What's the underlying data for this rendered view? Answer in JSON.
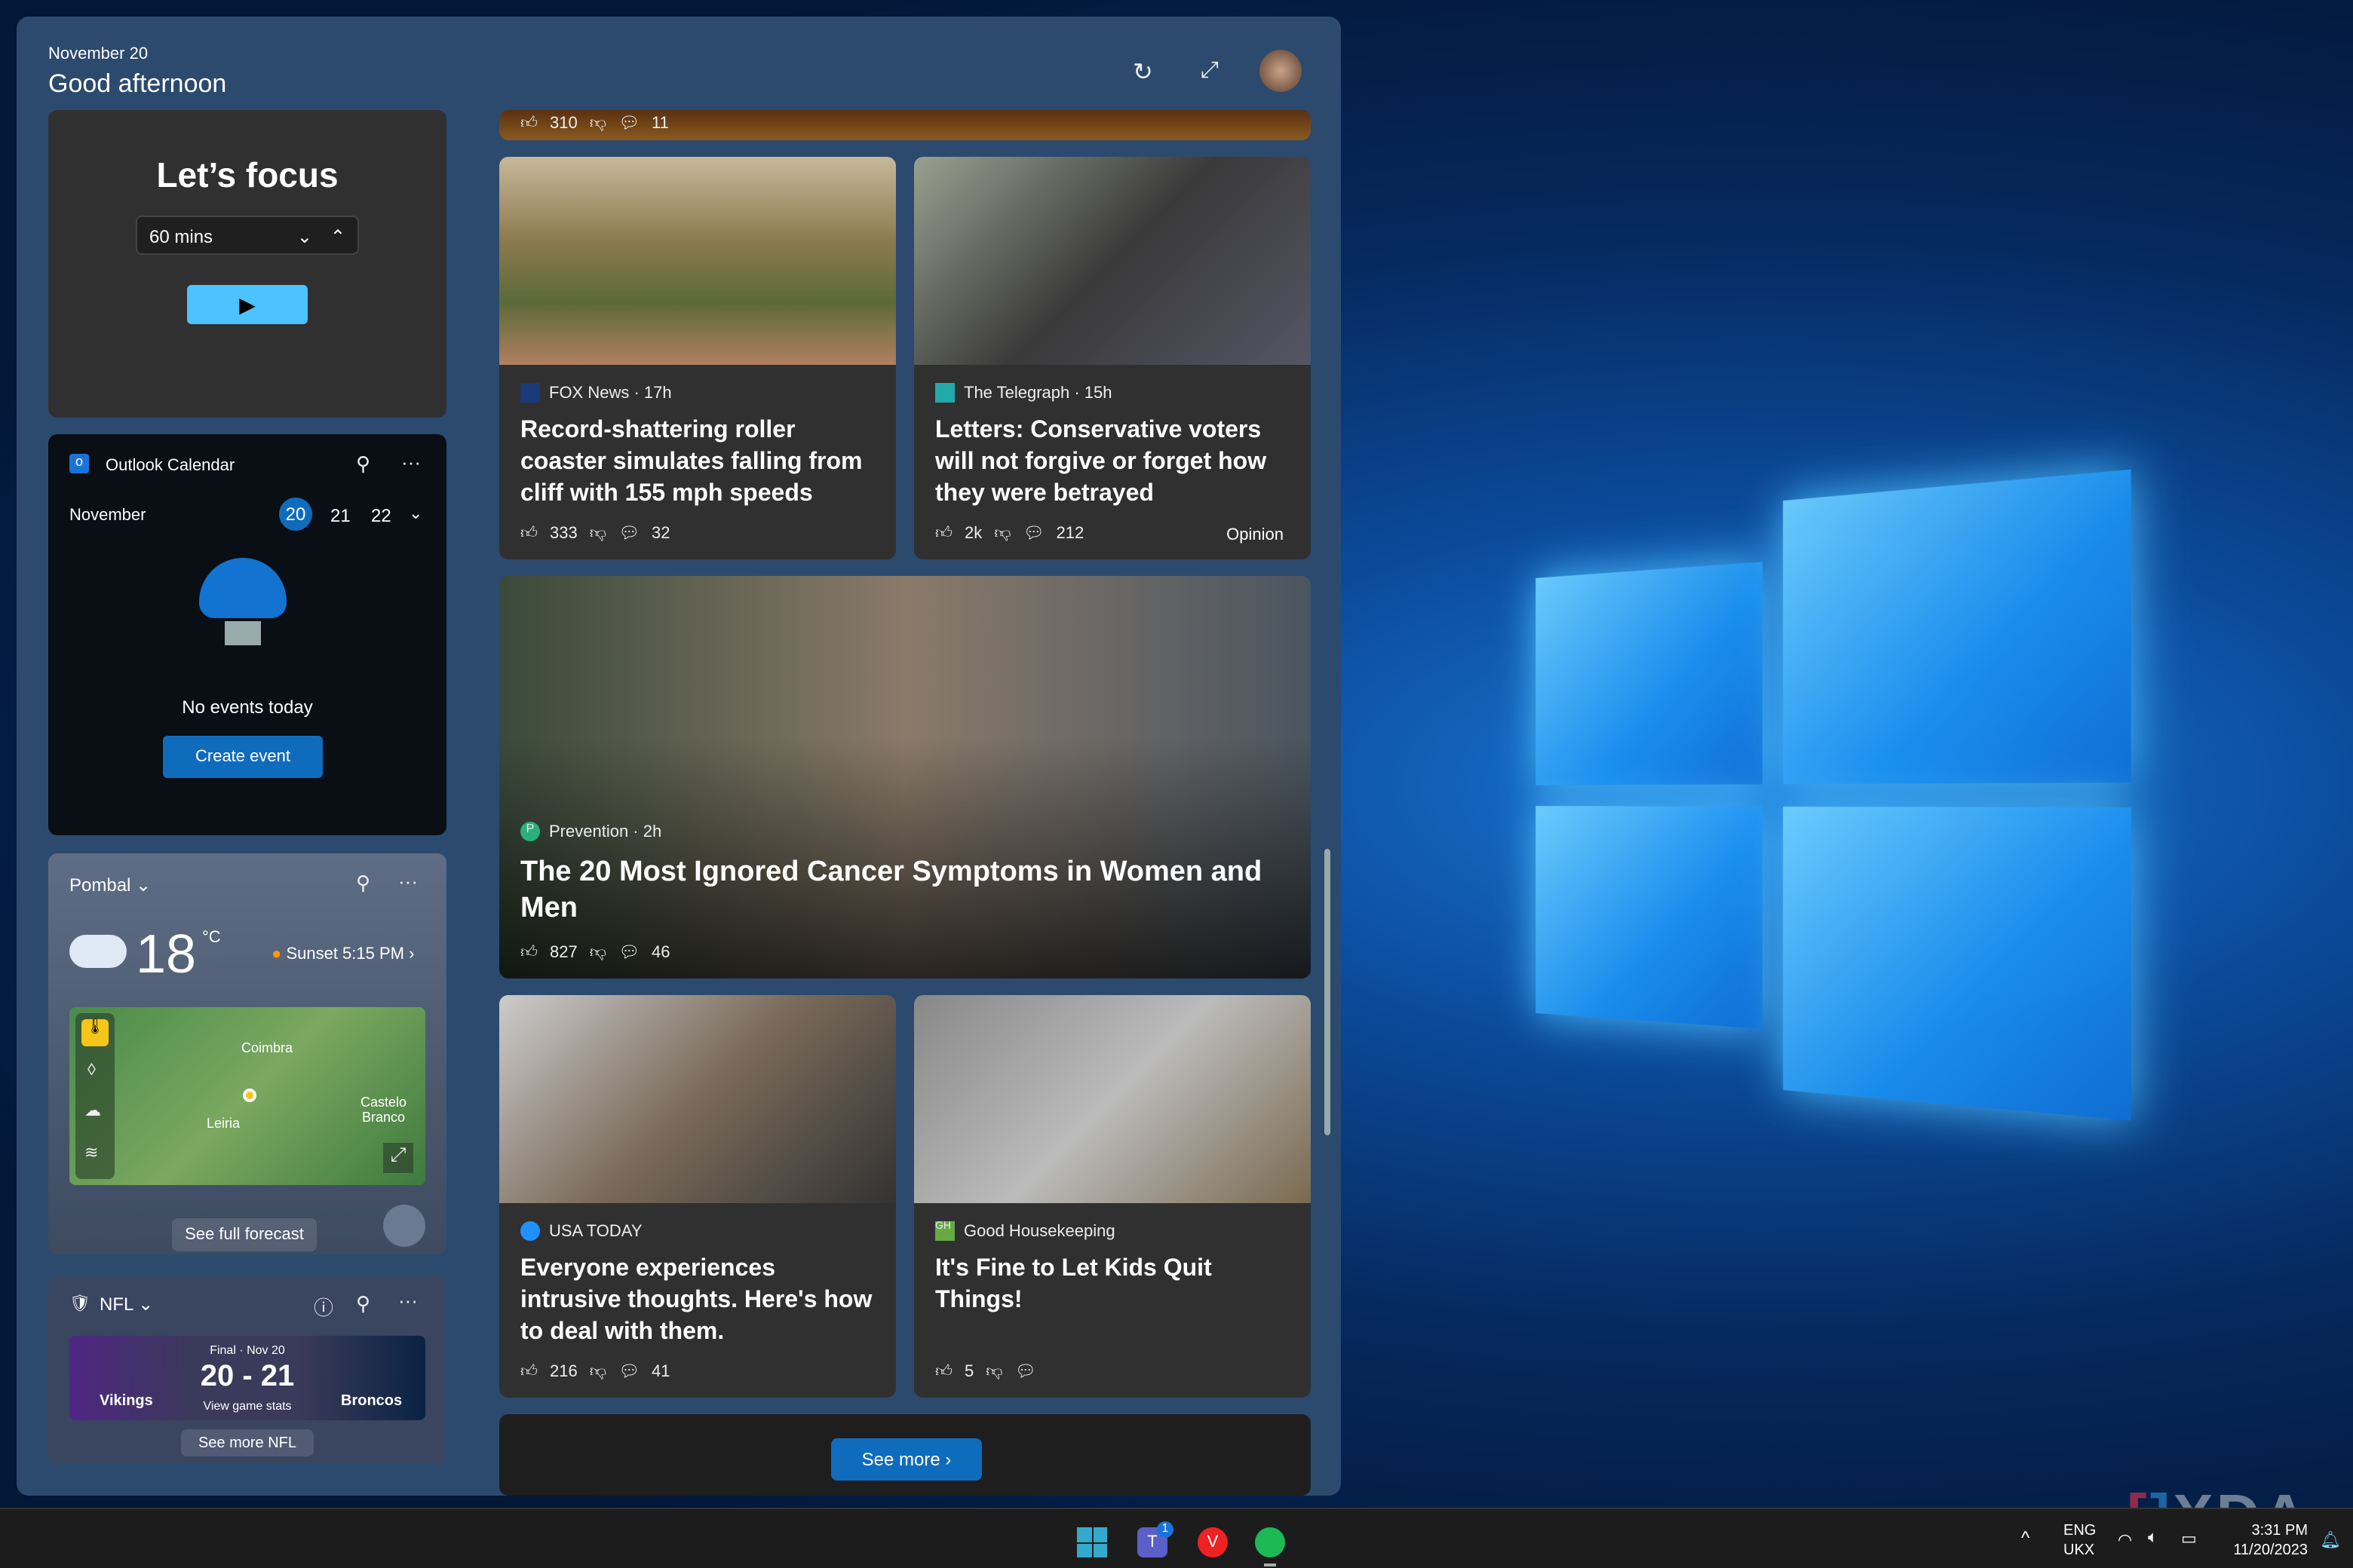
{
  "header": {
    "date": "November 20",
    "greeting": "Good afternoon",
    "refresh_icon": "refresh-icon",
    "expand_icon": "expand-icon"
  },
  "focus": {
    "title": "Let’s focus",
    "duration": "60 mins"
  },
  "calendar": {
    "title": "Outlook Calendar",
    "month": "November",
    "days": [
      "20",
      "21",
      "22"
    ],
    "selected_day": "20",
    "empty": "No events today",
    "create": "Create event"
  },
  "weather": {
    "location": "Pombal",
    "temp": "18",
    "unit": "°C",
    "sunset": "Sunset 5:15 PM",
    "map_labels": [
      "Coimbra",
      "Leiria",
      "Castelo",
      "Branco"
    ],
    "forecast": "See full forecast"
  },
  "nfl": {
    "title": "NFL",
    "status": "Final · Nov 20",
    "score": "20 - 21",
    "stats": "View game stats",
    "team1": "Vikings",
    "team2": "Broncos",
    "more": "See more NFL"
  },
  "feed": {
    "top": {
      "likes": "310",
      "comments": "11"
    },
    "cards": [
      {
        "source": "FOX News · 17h",
        "title": "Record-shattering roller coaster simulates falling from cliff with 155 mph speeds",
        "likes": "333",
        "comments": "32",
        "tag": ""
      },
      {
        "source": "The Telegraph · 15h",
        "title": "Letters: Conservative voters will not forgive or forget how they were betrayed",
        "likes": "2k",
        "comments": "212",
        "tag": "Opinion"
      },
      {
        "source": "Prevention · 2h",
        "title": "The 20 Most Ignored Cancer Symptoms in Women and Men",
        "likes": "827",
        "comments": "46",
        "tag": ""
      },
      {
        "source": "USA TODAY",
        "title": "Everyone experiences intrusive thoughts. Here's how to deal with them.",
        "likes": "216",
        "comments": "41",
        "tag": ""
      },
      {
        "source": "Good Housekeeping",
        "title": "It's Fine to Let Kids Quit Things!",
        "likes": "5",
        "comments": "",
        "tag": ""
      }
    ],
    "see_more": "See more"
  },
  "taskbar": {
    "lang1": "ENG",
    "lang2": "UKX",
    "time": "3:31 PM",
    "date": "11/20/2023",
    "teams_badge": "1"
  },
  "watermark": "XDA",
  "colors": {
    "accent": "#0f6cbd",
    "focus_button": "#4cc2ff",
    "panel": "#2c4a6d",
    "card": "#303030"
  }
}
